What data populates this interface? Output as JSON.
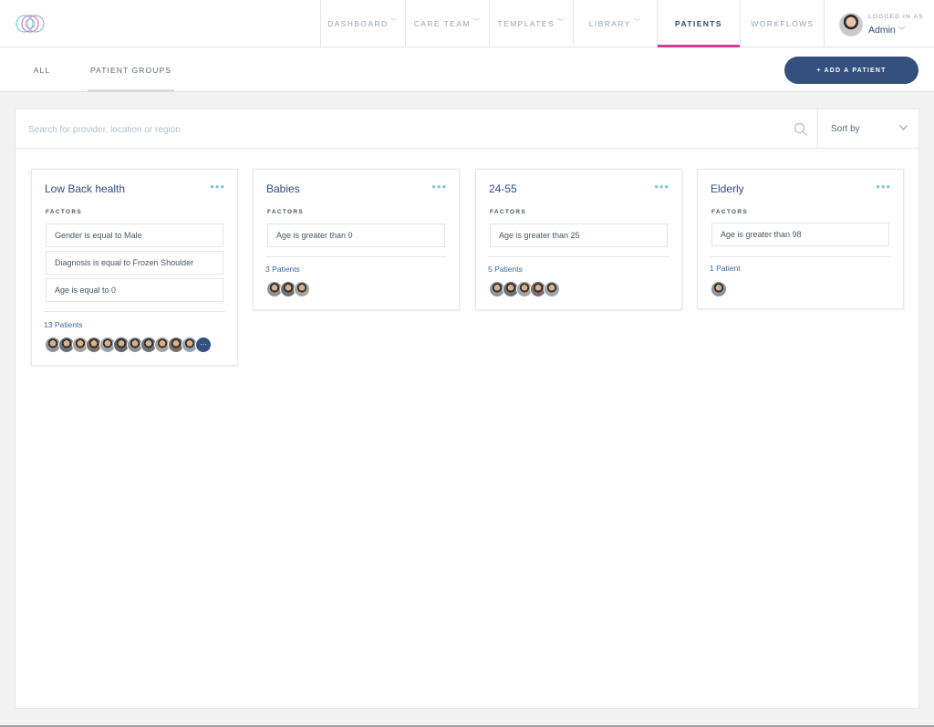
{
  "nav": {
    "items": [
      {
        "label": "DASHBOARD",
        "has_dropdown": true,
        "active": false
      },
      {
        "label": "CARE TEAM",
        "has_dropdown": true,
        "active": false
      },
      {
        "label": "TEMPLATES",
        "has_dropdown": true,
        "active": false
      },
      {
        "label": "LIBRARY",
        "has_dropdown": true,
        "active": false
      },
      {
        "label": "PATIENTS",
        "has_dropdown": false,
        "active": true
      },
      {
        "label": "WORKFLOWS",
        "has_dropdown": false,
        "active": false
      }
    ],
    "user": {
      "logged_in_label": "LOGGED IN AS",
      "name": "Admin"
    }
  },
  "subnav": {
    "tabs": [
      {
        "label": "ALL",
        "active": false
      },
      {
        "label": "PATIENT GROUPS",
        "active": true
      }
    ],
    "add_button_label": "+ ADD A PATIENT"
  },
  "search": {
    "placeholder": "Search for provider, location or region",
    "value": "",
    "sort_label": "Sort by"
  },
  "groups": [
    {
      "title": "Low Back health",
      "factors_label": "FACTORS",
      "factors": [
        "Gender is equal to Male",
        "Diagnosis is equal to Frozen Shoulder",
        "Age is equal to 0"
      ],
      "patients_label": "13 Patients",
      "avatar_count": 11,
      "more_label": "···"
    },
    {
      "title": "Babies",
      "factors_label": "FACTORS",
      "factors": [
        "Age is greater than 0"
      ],
      "patients_label": "3 Patients",
      "avatar_count": 3
    },
    {
      "title": "24-55",
      "factors_label": "FACTORS",
      "factors": [
        "Age is greater than 25"
      ],
      "patients_label": "5 Patients",
      "avatar_count": 5
    },
    {
      "title": "Elderly",
      "factors_label": "FACTORS",
      "factors": [
        "Age is greater than 98"
      ],
      "patients_label": "1 Patient",
      "avatar_count": 1
    }
  ],
  "colors": {
    "brand_navy": "#34507e",
    "active_tab_accent": "#d63a95",
    "card_dots": "#7ec9d6",
    "link_blue": "#3a6aa6"
  }
}
